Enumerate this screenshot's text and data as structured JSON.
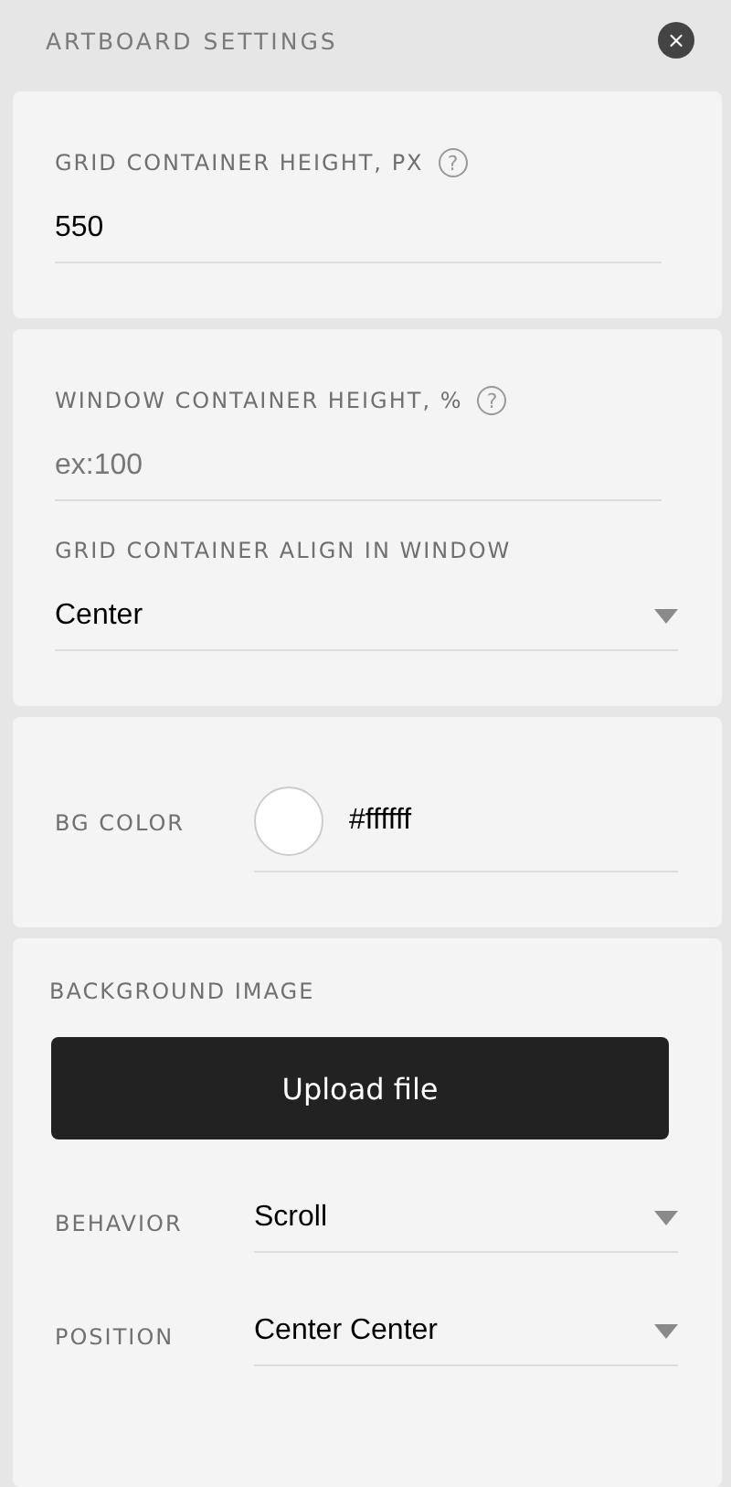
{
  "header": {
    "title": "ARTBOARD SETTINGS",
    "close": "×"
  },
  "cards": [
    {
      "fields": [
        {
          "kind": "input",
          "label": "GRID CONTAINER HEIGHT, PX",
          "help": "?",
          "value": "550"
        }
      ]
    },
    {
      "fields": [
        {
          "kind": "input",
          "label": "WINDOW CONTAINER HEIGHT, %",
          "help": "?",
          "placeholder": "ex:100"
        },
        {
          "kind": "select",
          "label": "GRID CONTAINER ALIGN IN WINDOW",
          "value": "Center"
        }
      ]
    },
    {
      "fields": [
        {
          "kind": "color",
          "label": "BG COLOR",
          "color": "#ffffff",
          "value": "#ffffff"
        }
      ]
    },
    {
      "title": "BACKGROUND IMAGE",
      "fields": [
        {
          "kind": "button",
          "label": "Upload file"
        },
        {
          "kind": "inline-select",
          "label": "BEHAVIOR",
          "value": "Scroll"
        },
        {
          "kind": "inline-select",
          "label": "POSITION",
          "value": "Center Center"
        }
      ]
    }
  ]
}
